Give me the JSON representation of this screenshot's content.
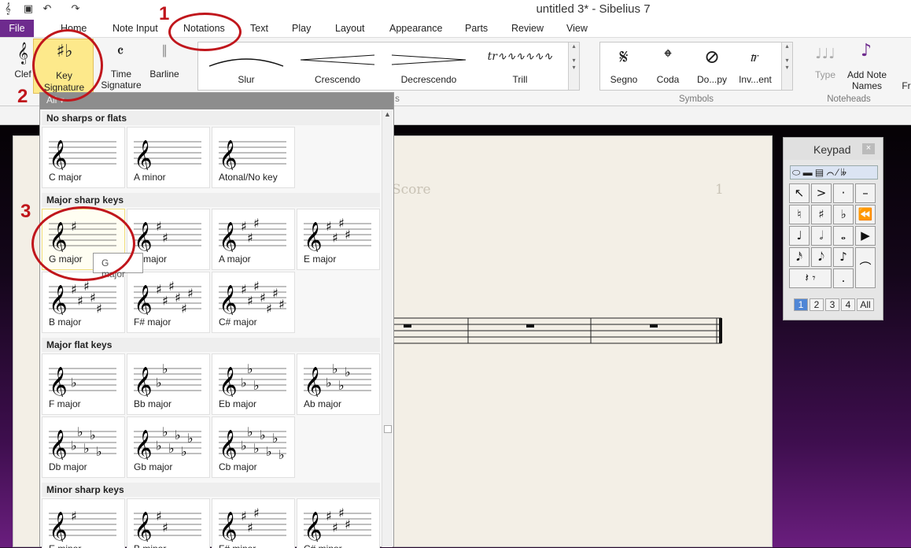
{
  "window": {
    "title": "untitled 3* - Sibelius 7"
  },
  "tabs": [
    "File",
    "Home",
    "Note Input",
    "Notations",
    "Text",
    "Play",
    "Layout",
    "Appearance",
    "Parts",
    "Review",
    "View"
  ],
  "ribbon": {
    "clef": "Clef",
    "key_signature": [
      "Key",
      "Signature"
    ],
    "time_signature": [
      "Time",
      "Signature"
    ],
    "barline": "Barline",
    "lines": [
      "Slur",
      "Crescendo",
      "Decrescendo",
      "Trill"
    ],
    "symbols": [
      "Segno",
      "Coda",
      "Do...py",
      "Inv...ent"
    ],
    "symbols_group": "Symbols",
    "type": "Type",
    "add_note_names": [
      "Add Note",
      "Names"
    ],
    "noteheads_group": "Noteheads",
    "lines_group_fragment": "s",
    "edge_label": "Fr"
  },
  "dropdown": {
    "filter": "All",
    "sections": [
      {
        "title": "No sharps or flats",
        "keys": [
          {
            "name": "C major",
            "acc": "none",
            "n": 0
          },
          {
            "name": "A minor",
            "acc": "none",
            "n": 0
          },
          {
            "name": "Atonal/No key",
            "acc": "none",
            "n": 0
          }
        ]
      },
      {
        "title": "Major sharp keys",
        "keys": [
          {
            "name": "G major",
            "acc": "sharp",
            "n": 1
          },
          {
            "name": "D major",
            "acc": "sharp",
            "n": 2
          },
          {
            "name": "A major",
            "acc": "sharp",
            "n": 3
          },
          {
            "name": "E major",
            "acc": "sharp",
            "n": 4
          },
          {
            "name": "B major",
            "acc": "sharp",
            "n": 5
          },
          {
            "name": "F# major",
            "acc": "sharp",
            "n": 6
          },
          {
            "name": "C# major",
            "acc": "sharp",
            "n": 7
          }
        ]
      },
      {
        "title": "Major flat keys",
        "keys": [
          {
            "name": "F major",
            "acc": "flat",
            "n": 1
          },
          {
            "name": "Bb major",
            "acc": "flat",
            "n": 2
          },
          {
            "name": "Eb major",
            "acc": "flat",
            "n": 3
          },
          {
            "name": "Ab major",
            "acc": "flat",
            "n": 4
          },
          {
            "name": "Db major",
            "acc": "flat",
            "n": 5
          },
          {
            "name": "Gb major",
            "acc": "flat",
            "n": 6
          },
          {
            "name": "Cb major",
            "acc": "flat",
            "n": 7
          }
        ]
      },
      {
        "title": "Minor sharp keys",
        "keys": [
          {
            "name": "E minor",
            "acc": "sharp",
            "n": 1
          },
          {
            "name": "B minor",
            "acc": "sharp",
            "n": 2
          },
          {
            "name": "F# minor",
            "acc": "sharp",
            "n": 3
          },
          {
            "name": "C# minor",
            "acc": "sharp",
            "n": 4
          }
        ]
      }
    ]
  },
  "tooltip": "G major",
  "score": {
    "title_fragment": "Score",
    "page_number": "1"
  },
  "keypad": {
    "title": "Keypad",
    "close": "×",
    "tabs": [
      "1",
      "2",
      "3",
      "4",
      "All"
    ],
    "active_tab": "1",
    "buttons": [
      "↖",
      ">",
      "·",
      "–",
      "♮",
      "♯",
      "♭",
      "⏪",
      "♩",
      "𝅗𝅥",
      "𝅝",
      "▶",
      "𝅘𝅥𝅯",
      "𝅘𝅥𝅮",
      "♪",
      "𝄽 𝄾",
      ".",
      "⌒"
    ]
  },
  "annotations": [
    "1",
    "2",
    "3"
  ],
  "colors": {
    "file_tab": "#6e2b8e",
    "annotation": "#c0161c",
    "ribbon_highlight": "#fde98b",
    "keypad_active": "#4f86d6"
  }
}
